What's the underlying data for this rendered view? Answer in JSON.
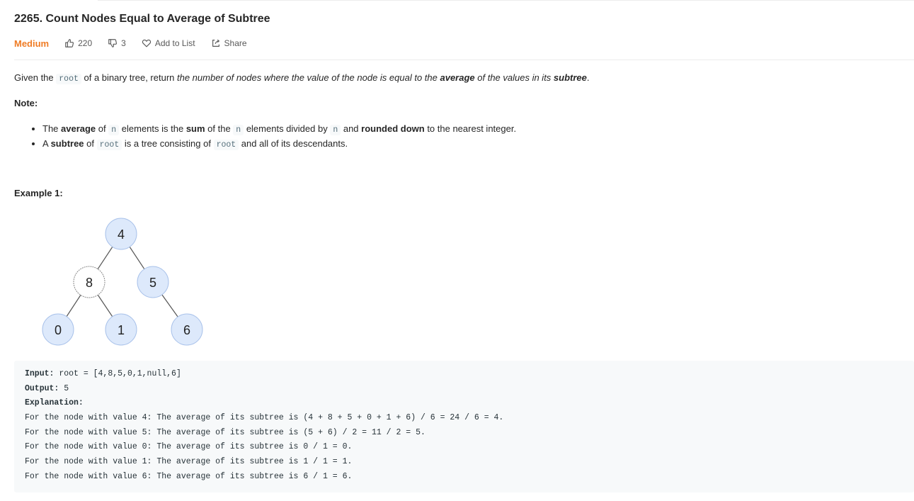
{
  "problem": {
    "title": "2265. Count Nodes Equal to Average of Subtree",
    "difficulty": "Medium",
    "likes": "220",
    "dislikes": "3",
    "add_to_list": "Add to List",
    "share": "Share"
  },
  "description": {
    "p1": "Given the ",
    "code1": "root",
    "p2": " of a binary tree, return ",
    "em1": "the number of nodes where the value of the node is equal to the ",
    "em_bold1": "average",
    "em2": " of the values in its ",
    "em_bold2": "subtree",
    "p3": "."
  },
  "note": {
    "label": "Note:",
    "b1": {
      "t1": "The ",
      "bold1": "average",
      "t2": " of ",
      "code1": "n",
      "t3": " elements is the ",
      "bold2": "sum",
      "t4": " of the ",
      "code2": "n",
      "t5": " elements divided by ",
      "code3": "n",
      "t6": " and ",
      "bold3": "rounded down",
      "t7": " to the nearest integer."
    },
    "b2": {
      "t1": "A ",
      "bold1": "subtree",
      "t2": " of ",
      "code1": "root",
      "t3": " is a tree consisting of ",
      "code2": "root",
      "t4": " and all of its descendants."
    }
  },
  "example": {
    "label": "Example 1:",
    "tree_nodes": [
      "4",
      "8",
      "5",
      "0",
      "1",
      "6"
    ],
    "input_label": "Input:",
    "input_value": " root = [4,8,5,0,1,null,6]",
    "output_label": "Output:",
    "output_value": " 5",
    "explanation_label": "Explanation:",
    "explanation_lines": [
      "For the node with value 4: The average of its subtree is (4 + 8 + 5 + 0 + 1 + 6) / 6 = 24 / 6 = 4.",
      "For the node with value 5: The average of its subtree is (5 + 6) / 2 = 11 / 2 = 5.",
      "For the node with value 0: The average of its subtree is 0 / 1 = 0.",
      "For the node with value 1: The average of its subtree is 1 / 1 = 1.",
      "For the node with value 6: The average of its subtree is 6 / 1 = 6."
    ]
  },
  "colors": {
    "difficulty": "#ef7c25",
    "node_fill": "#dde9fb",
    "node_stroke": "#a9c2ea",
    "node_white_stroke": "#8a8a8a"
  },
  "icons": {
    "like": "thumbs-up-icon",
    "dislike": "thumbs-down-icon",
    "add": "heart-icon",
    "share": "share-icon"
  }
}
